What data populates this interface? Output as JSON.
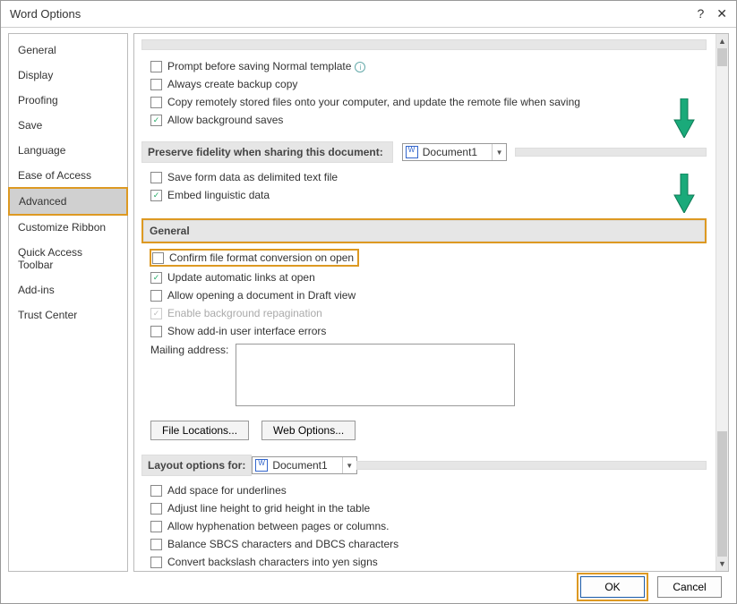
{
  "title": "Word Options",
  "sidebar": {
    "items": [
      {
        "label": "General"
      },
      {
        "label": "Display"
      },
      {
        "label": "Proofing"
      },
      {
        "label": "Save"
      },
      {
        "label": "Language"
      },
      {
        "label": "Ease of Access"
      },
      {
        "label": "Advanced",
        "selected": true
      },
      {
        "label": "Customize Ribbon"
      },
      {
        "label": "Quick Access Toolbar"
      },
      {
        "label": "Add-ins"
      },
      {
        "label": "Trust Center"
      }
    ]
  },
  "section_save": {
    "opt_prompt_normal": "Prompt before saving Normal template",
    "opt_backup": "Always create backup copy",
    "opt_remote": "Copy remotely stored files onto your computer, and update the remote file when saving",
    "opt_bg_saves": "Allow background saves"
  },
  "section_fidelity": {
    "heading": "Preserve fidelity when sharing this document:",
    "doc_selector": "Document1",
    "opt_form_data": "Save form data as delimited text file",
    "opt_embed_ling": "Embed linguistic data"
  },
  "section_general": {
    "heading": "General",
    "opt_confirm_conv": "Confirm file format conversion on open",
    "opt_update_links": "Update automatic links at open",
    "opt_draft_view": "Allow opening a document in Draft view",
    "opt_bg_repag": "Enable background repagination",
    "opt_addin_errors": "Show add-in user interface errors",
    "mailing_label": "Mailing address:",
    "btn_file_loc": "File Locations...",
    "btn_web_opt": "Web Options..."
  },
  "section_layout": {
    "heading": "Layout options for:",
    "doc_selector": "Document1",
    "opt_underline_space": "Add space for underlines",
    "opt_line_height": "Adjust line height to grid height in the table",
    "opt_hyphen": "Allow hyphenation between pages or columns.",
    "opt_sbcs": "Balance SBCS characters and DBCS characters",
    "opt_yen": "Convert backslash characters into yen signs"
  },
  "footer": {
    "ok": "OK",
    "cancel": "Cancel"
  }
}
